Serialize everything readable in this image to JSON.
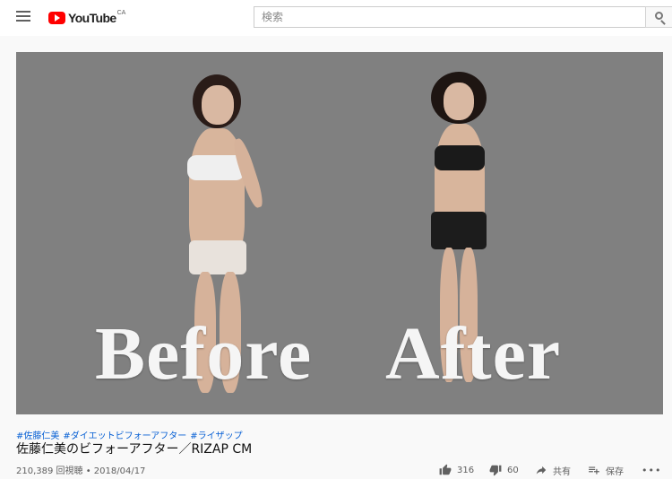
{
  "header": {
    "logo_text": "YouTube",
    "logo_country": "CA",
    "search_placeholder": "検索"
  },
  "video": {
    "caption_before": "Before",
    "caption_after": "After",
    "background_color": "#808080"
  },
  "info": {
    "hashtags": [
      "#佐藤仁美",
      "#ダイエットビフォーアフター",
      "#ライザップ"
    ],
    "title": "佐藤仁美のビフォーアフター／RIZAP CM",
    "meta": "210,389 回視聴 • 2018/04/17"
  },
  "actions": {
    "likes": "316",
    "dislikes": "60",
    "share_label": "共有",
    "save_label": "保存",
    "more_label": "•••"
  },
  "colors": {
    "accent": "#ff0000",
    "link": "#065fd4"
  }
}
